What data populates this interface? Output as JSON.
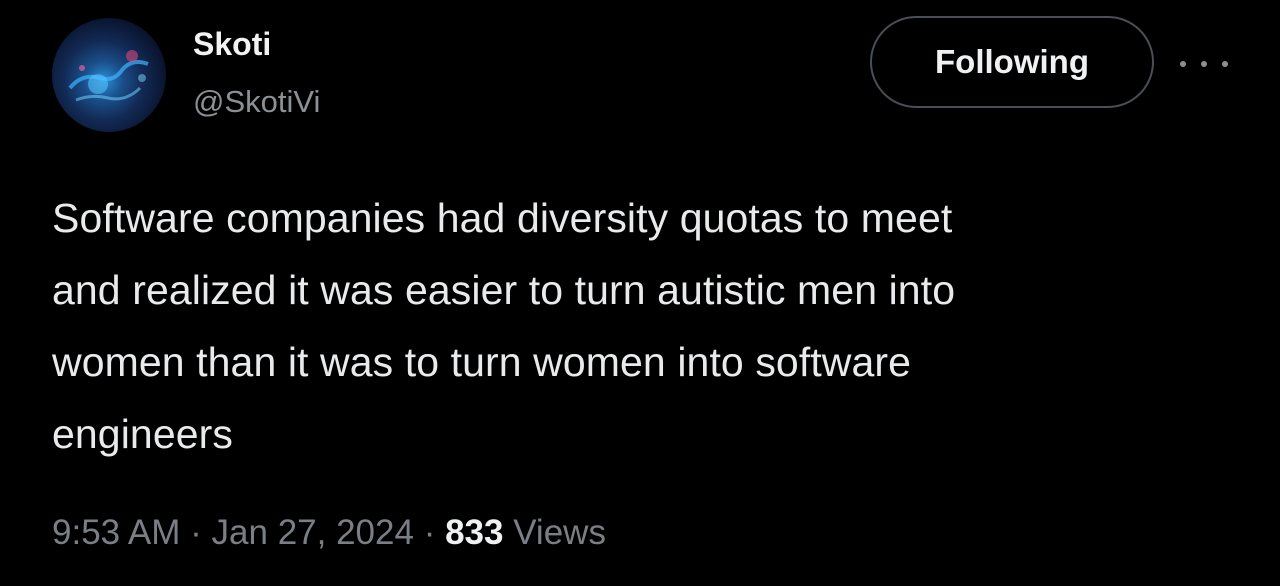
{
  "user": {
    "display_name": "Skoti",
    "handle": "@SkotiVi"
  },
  "actions": {
    "follow_label": "Following",
    "more_icon": "more-horizontal-icon"
  },
  "tweet": {
    "text_lines": [
      "Software companies had diversity quotas to meet",
      "and realized it was easier to turn autistic men into",
      "women than it was to turn women into software",
      "engineers"
    ],
    "time": "9:53 AM",
    "date": "Jan 27, 2024",
    "separator": "·",
    "views_count": "833",
    "views_label": "Views"
  },
  "colors": {
    "background": "#000000",
    "primary_text": "#e7e9ea",
    "secondary_text": "#8b9096",
    "button_border": "#4a4f55"
  }
}
